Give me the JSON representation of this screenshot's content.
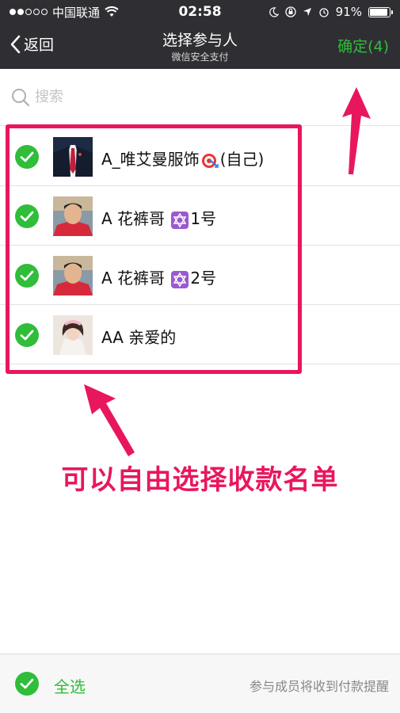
{
  "status_bar": {
    "carrier": "中国联通",
    "time": "02:58",
    "battery": "91%",
    "battery_level": 0.91
  },
  "nav": {
    "back_label": "返回",
    "title": "选择参与人",
    "subtitle": "微信安全支付",
    "confirm_label": "确定(4)"
  },
  "search": {
    "placeholder": "搜索"
  },
  "contacts": [
    {
      "name": "A_唯艾曼服饰",
      "emoji": "target-emoji",
      "suffix": "(自己)",
      "selected": true
    },
    {
      "name": "A 花裤哥 ",
      "emoji": "star-of-david-emoji",
      "suffix": "1号",
      "selected": true
    },
    {
      "name": "A 花裤哥 ",
      "emoji": "star-of-david-emoji",
      "suffix": "2号",
      "selected": true
    },
    {
      "name": "AA 亲爱的",
      "emoji": "",
      "suffix": "",
      "selected": true
    }
  ],
  "annotation": {
    "text": "可以自由选择收款名单"
  },
  "bottom": {
    "select_all_label": "全选",
    "hint": "参与成员将收到付款提醒"
  },
  "colors": {
    "accent_green": "#2fbd3a",
    "annotation_pink": "#e8175d",
    "nav_background": "#2f2f33"
  }
}
